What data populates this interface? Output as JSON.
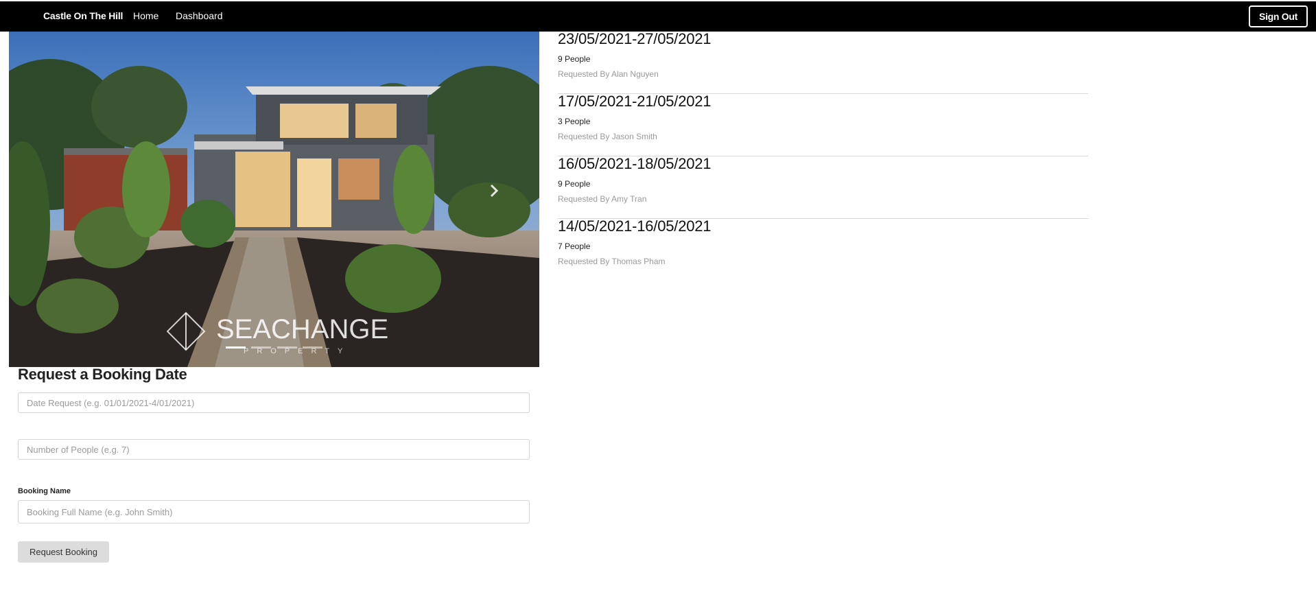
{
  "nav": {
    "brand": "Castle On The Hill",
    "links": [
      "Home",
      "Dashboard"
    ],
    "sign_out": "Sign Out"
  },
  "carousel": {
    "watermark_brand": "SEACHANGE",
    "watermark_sub": "PROPERTY",
    "slide_count": 4,
    "active_slide": 1,
    "next_icon": "chevron-right-icon"
  },
  "booking_form": {
    "title": "Request a Booking Date",
    "date_placeholder": "Date Request (e.g. 01/01/2021-4/01/2021)",
    "people_placeholder": "Number of People (e.g. 7)",
    "name_label": "Booking Name",
    "name_placeholder": "Booking Full Name (e.g. John Smith)",
    "submit_label": "Request Booking"
  },
  "bookings": [
    {
      "dates": "23/05/2021-27/05/2021",
      "people": "9 People",
      "requested_by": "Requested By Alan Nguyen"
    },
    {
      "dates": "17/05/2021-21/05/2021",
      "people": "3 People",
      "requested_by": "Requested By Jason Smith"
    },
    {
      "dates": "16/05/2021-18/05/2021",
      "people": "9 People",
      "requested_by": "Requested By Amy Tran"
    },
    {
      "dates": "14/05/2021-16/05/2021",
      "people": "7 People",
      "requested_by": "Requested By Thomas Pham"
    }
  ]
}
